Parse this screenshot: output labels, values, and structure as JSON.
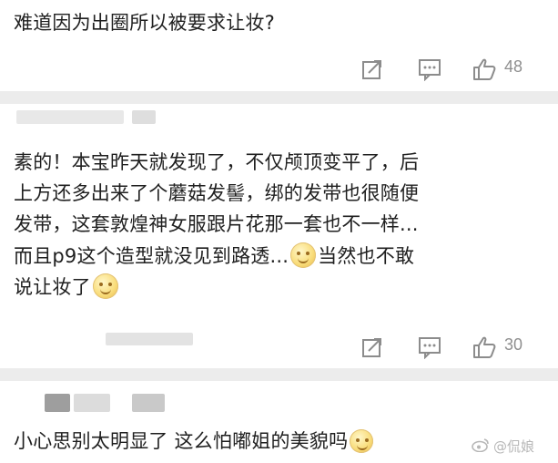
{
  "comments": [
    {
      "text_lines": [
        "难道因为出圈所以被要求让妆?"
      ],
      "like_count": "48"
    },
    {
      "text_lines": [
        "素的！本宝昨天就发现了，不仅颅顶变平了，后",
        "上方还多出来了个蘑菇发髻，绑的发带也很随便",
        "发带，这套敦煌神女服跟片花那一套也不一样...",
        "而且p9这个造型就没见到路透...",
        "当然也不敢",
        "说让妆了"
      ],
      "like_count": "30"
    },
    {
      "text_lines": [
        "小心思别太明显了 这么怕嘟姐的美貌吗"
      ]
    }
  ],
  "watermark": {
    "text": "@侃娘",
    "icon": "weibo-logo-icon"
  },
  "icons": {
    "share": "share-icon",
    "comment": "comment-icon",
    "like": "thumbs-up-icon",
    "emoji": "smile-emoji-icon"
  },
  "colors": {
    "icon": "#8c8c8c",
    "separator": "#ececec",
    "text": "#1f1f1f",
    "blur": "#d9d9d9"
  }
}
